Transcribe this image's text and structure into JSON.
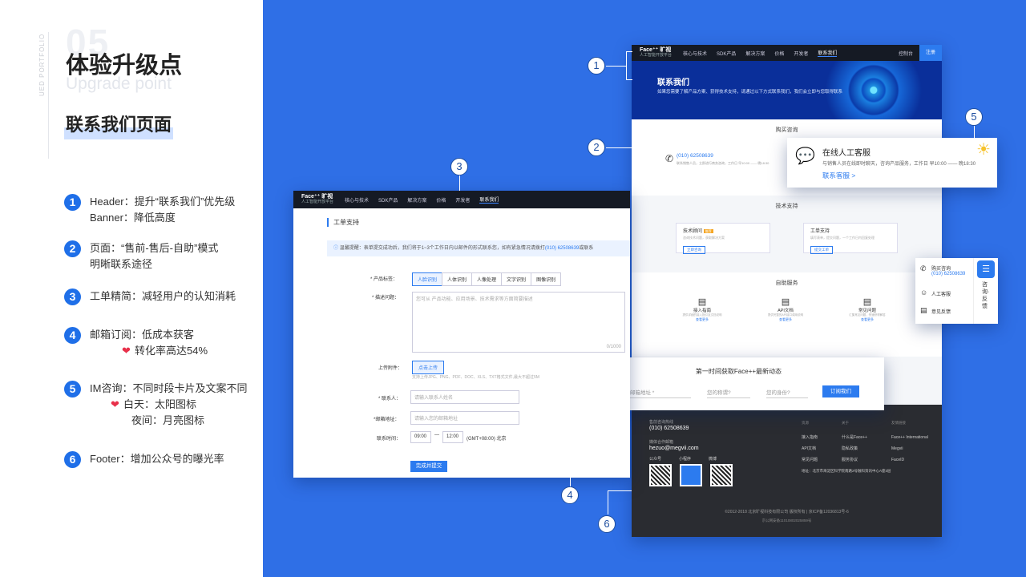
{
  "slide": {
    "bignum": "05",
    "vertical": "UED PORTFOLIO",
    "title_cn": "体验升级点",
    "title_en": "Upgrade point",
    "subtitle": "联系我们页面"
  },
  "features": [
    {
      "n": "1",
      "lines": [
        "Header：提升“联系我们”优先级",
        "Banner：降低高度"
      ]
    },
    {
      "n": "2",
      "lines": [
        "页面：“售前-售后-自助”模式",
        "明晰联系途径"
      ]
    },
    {
      "n": "3",
      "lines": [
        "工单精简：减轻用户的认知消耗"
      ]
    },
    {
      "n": "4",
      "lines": [
        "邮箱订阅：低成本获客",
        "转化率高达54%"
      ]
    },
    {
      "n": "5",
      "lines": [
        "IM咨询：不同时段卡片及文案不同",
        "白天：太阳图标",
        "夜间：月亮图标"
      ]
    },
    {
      "n": "6",
      "lines": [
        "Footer：增加公众号的曝光率"
      ]
    }
  ],
  "icons": {
    "heart": "heart-icon",
    "sun": "sun-icon",
    "chat": "chat-icon",
    "phone": "phone-icon",
    "doc": "document-icon"
  },
  "colors": {
    "accent": "#1f6fe8",
    "bg_blue": "#2f6fe6",
    "heart": "#e8304a"
  },
  "callouts": [
    "1",
    "2",
    "3",
    "4",
    "5",
    "6"
  ],
  "site": {
    "logo": "Face⁺⁺ 旷视",
    "logo_sub": "人工智能开放平台",
    "nav": [
      "核心与技术",
      "SDK产品",
      "解决方案",
      "价格",
      "开发者",
      "联系我们"
    ],
    "console": "控制台",
    "register": "注册",
    "banner_title": "联系我们",
    "banner_desc": "如果您需要了解产品方案、获得技术支持，请通过以下方式联系我们，我们会立即与您取得联系",
    "buy_title": "购买咨询",
    "buy_phone": "(010) 62508639",
    "buy_desc": "联系销售人员，立即进行商务咨询，工作日 早10:00 —— 晚18:30",
    "tech_title": "技术支持",
    "tech_cards": [
      {
        "title": "技术顾问",
        "badge": "推荐",
        "desc": "咨询技术问题，获取解决方案",
        "btn": "立即咨询"
      },
      {
        "title": "工单支持",
        "desc": "填写表单，提交问题，一个工作日内回复处理",
        "btn": "提交工单"
      }
    ],
    "self_title": "自助服务",
    "self_items": [
      {
        "title": "接入指南",
        "desc": "提供详细的接入指引及文档说明",
        "link": "查看更多"
      },
      {
        "title": "API文档",
        "desc": "提供完整的API接口调用说明",
        "link": "查看更多"
      },
      {
        "title": "常见问题",
        "desc": "汇集常见问题，快速获得解答",
        "link": "查看更多"
      }
    ],
    "sub_title": "第一时间获取Face++最新动态",
    "sub_email": "邮箱地址 *",
    "sub_name": "您的称谓?",
    "sub_role": "您的身份?",
    "sub_btn": "订阅我们",
    "footer": {
      "hotline_label": "售前咨询热线",
      "hotline": "(010) 62508639",
      "email_label": "媒体合作邮箱",
      "email": "hezuo@megvii.com",
      "socials": [
        "公众号",
        "小程序",
        "微博"
      ],
      "col1_title": "资源",
      "col1": [
        "接入指南",
        "API文档",
        "常见问题"
      ],
      "col2_title": "关于",
      "col2": [
        "什么是Face++",
        "隐私政策",
        "服务协议"
      ],
      "col3_title": "友情链接",
      "col3": [
        "Face++ International",
        "Megvii",
        "FaceID"
      ],
      "address": "地址：北京市海淀区科学院南路2号融科资讯中心A座3层",
      "copyright": "©2012-2018 北京旷视科技有限公司 版权所有 | 京ICP备12036813号-6",
      "beian": "京公网安备11010802025859号"
    }
  },
  "ticket": {
    "title": "工单支持",
    "notice_label": "温馨提醒：",
    "notice": "表单提交成功后，我们将于1~3个工作日内以邮件的形式联系您，如有紧急情况请拨打",
    "notice_phone": "(010) 62508639",
    "notice_tail": "或联系",
    "tags_label": "* 产品标签：",
    "tags": [
      "人脸识别",
      "人体识别",
      "人像处理",
      "文字识别",
      "图像识别"
    ],
    "desc_label": "* 描述问题：",
    "desc_placeholder": "您可从 产品功能、应用场景、技术需求等方面简要描述",
    "counter": "0/1000",
    "upload_label": "上传附件：",
    "upload_btn": "点击上传",
    "upload_hint": "支持上传JPG、PNG、PDF、DOC、XLS、TXT格式文件,最大不超过5M",
    "contact_label": "* 联系人：",
    "contact_ph": "请输入联系人姓名",
    "email_label": "*邮箱地址：",
    "email_ph": "请输入您的邮箱地址",
    "time_label": "联系时间：",
    "time_from": "09:00",
    "time_to": "12:00",
    "timezone": "(GMT+08:00) 北京",
    "submit": "完成并提交"
  },
  "im": {
    "title": "在线人工客服",
    "desc": "与销售人员在线即时聊天，咨询产品服务，工作日 早10:00 —— 晚18:30",
    "link": "联系客服 >"
  },
  "sidebar": {
    "items": [
      "购买咨询",
      "(010) 62508639",
      "人工客服",
      "意见反馈"
    ],
    "tab": "咨询·反馈"
  }
}
